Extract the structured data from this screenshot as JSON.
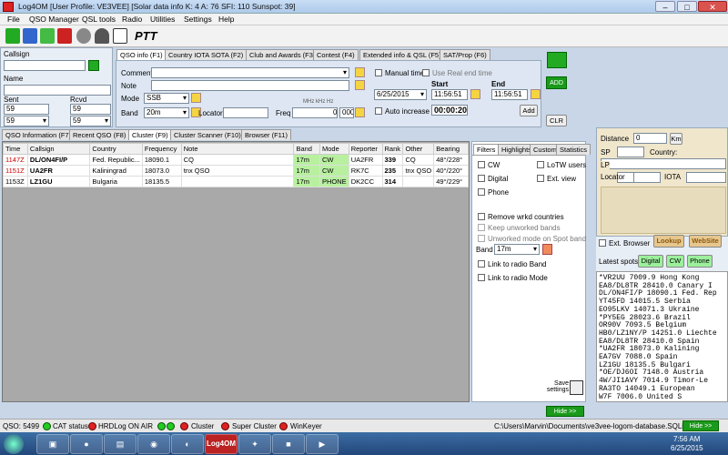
{
  "window": {
    "title": "Log4OM [User Profile: VE3VEE] [Solar data info K: 4 A: 76 SFI: 110 Sunspot: 39]"
  },
  "menu": [
    "File",
    "QSO Manager",
    "QSL tools",
    "Radio",
    "Utilities",
    "Settings",
    "Help"
  ],
  "toolbar": {
    "ptt": "PTT",
    "icons": [
      "wifi-icon",
      "disk-icon",
      "leaf-icon",
      "card-icon",
      "clock-icon",
      "headphones-icon",
      "satellite-icon"
    ]
  },
  "entry": {
    "callsign_label": "Callsign",
    "name_label": "Name",
    "sent_label": "Sent",
    "rcvd_label": "Rcvd",
    "sent_value": "59",
    "rcvd_value": "59",
    "sent_sel": "59",
    "rcvd_sel": "59"
  },
  "qso_tabs": [
    "QSO info (F1)",
    "Country IOTA SOTA (F2)",
    "Club and Awards (F3)",
    "Contest (F4)",
    "Extended info & QSL (F5)",
    "SAT/Prop (F6)"
  ],
  "qso": {
    "comment_label": "Comment",
    "note_label": "Note",
    "mode_label": "Mode",
    "mode_value": "SSB",
    "band_label": "Band",
    "band_value": "20m",
    "locator_label": "Locator",
    "freq_label": "Freq",
    "freq_units": "MHz    kHz    Hz",
    "freq_mhz": "",
    "freq_khz": "0",
    "freq_hz": "000",
    "manual_time": "Manual time",
    "real_end_time": "Use Real end time",
    "date": "6/25/2015",
    "start_label": "Start",
    "end_label": "End",
    "start_time": "11:56:51",
    "end_time": "11:56:51",
    "auto_increase": "Auto increase",
    "duration": "00:00:20",
    "add_small": "Add",
    "add": "ADD",
    "clr": "CLR"
  },
  "lower_tabs": [
    "QSO Information (F7)",
    "Recent QSO (F8)",
    "Cluster (F9)",
    "Cluster Scanner (F10)",
    "Browser (F11)"
  ],
  "cluster": {
    "headers": [
      "Time",
      "Callsign",
      "Country",
      "Frequency",
      "Note",
      "Band",
      "Mode",
      "Reporter",
      "Rank",
      "Other",
      "Bearing"
    ],
    "rows": [
      {
        "time": "1147Z",
        "call": "DL/ON4FI/P",
        "country": "Fed. Republic...",
        "freq": "18090.1",
        "note": "CQ",
        "band": "17m",
        "mode": "CW",
        "reporter": "UA2FR",
        "rank": "339",
        "other": "CQ",
        "bearing": "48°/228°"
      },
      {
        "time": "1151Z",
        "call": "UA2FR",
        "country": "Kaliningrad",
        "freq": "18073.0",
        "note": "tnx QSO",
        "band": "17m",
        "mode": "CW",
        "reporter": "RK7C",
        "rank": "235",
        "other": "tnx QSO",
        "bearing": "40°/220°"
      },
      {
        "time": "1153Z",
        "call": "LZ1GU",
        "country": "Bulgaria",
        "freq": "18135.5",
        "note": "",
        "band": "17m",
        "mode": "PHONE",
        "reporter": "DK2CC",
        "rank": "314",
        "other": "",
        "bearing": "49°/229°"
      }
    ]
  },
  "filters": {
    "tabs": [
      "Filters",
      "Highlights",
      "Custom",
      "Statistics"
    ],
    "cw": "CW",
    "lotw": "LoTW users",
    "digital": "Digital",
    "ext_view": "Ext. view",
    "phone": "Phone",
    "remove_wrkd": "Remove wrkd countries",
    "keep_unworked": "Keep unworked bands",
    "unworked_mode": "Unworked mode on Spot band",
    "band_label": "Band",
    "band_value": "17m",
    "link_band": "Link to radio Band",
    "link_mode": "Link to radio Mode",
    "save": "Save settings"
  },
  "info": {
    "distance_label": "Distance",
    "distance_value": "0",
    "km": "Km",
    "sp_label": "SP",
    "country_label": "Country:",
    "lp_label": "LP",
    "locator_label": "Locator",
    "iota_label": "IOTA",
    "ext_browser": "Ext. Browser",
    "lookup": "Lookup",
    "website": "WebSite",
    "latest_spots": "Latest spots",
    "digital": "Digital",
    "cw": "CW",
    "phone": "Phone"
  },
  "spots": [
    "*VR2UU       7009.9 Hong Kong",
    " EA8/DL8TR  28410.0 Canary I",
    " DL/ON4FI/P 18090.1 Fed. Rep",
    " YT45FD     14015.5 Serbia",
    " EO95LKV    14071.3 Ukraine",
    "*PY5EG      28023.6 Brazil",
    " OR90V       7093.5 Belgium",
    " HB0/LZ1NY/P 14251.0 Liechte",
    " EA8/DL8TR  28410.0 Spain",
    "*UA2FR      18073.0 Kalining",
    " EA7GV       7088.0 Spain",
    " LZ1GU      18135.5 Bulgari",
    "*OE/DJ6OI    7148.0 Austria",
    " 4W/JI1AVY   7014.9 Timor-Le",
    " RA3TO      14049.1 European",
    " W7F         7006.0 United S"
  ],
  "hide": "Hide >>",
  "status": {
    "qso_count": "QSO:  5499",
    "cat": "CAT status",
    "hrdlog": "HRDLog ON AIR",
    "cluster": "Cluster",
    "super_cluster": "Super Cluster",
    "winkeyer": "WinKeyer",
    "db_path": "C:\\Users\\Marvin\\Documents\\ve3vee-logom-database.SQLite"
  },
  "taskbar": {
    "time": "7:56 AM",
    "date": "6/25/2015",
    "log4om_label": "Log4OM"
  }
}
